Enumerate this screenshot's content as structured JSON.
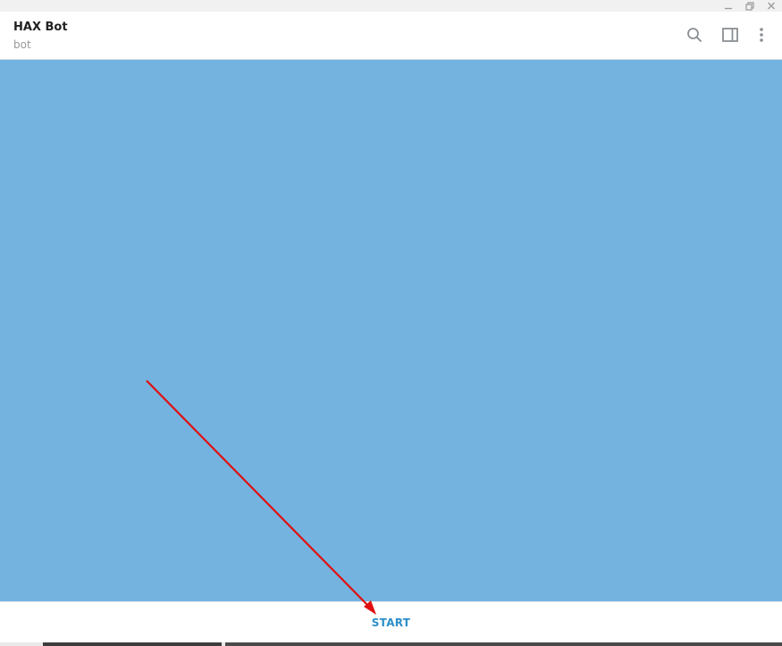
{
  "window": {
    "controls": [
      {
        "name": "minimize",
        "icon": "minimize-icon"
      },
      {
        "name": "restore",
        "icon": "restore-icon"
      },
      {
        "name": "close",
        "icon": "close-icon"
      }
    ]
  },
  "header": {
    "title": "HAX Bot",
    "status": "bot",
    "icons": [
      "search-icon",
      "sidebar-toggle-icon",
      "more-vertical-icon"
    ]
  },
  "chat": {
    "background_color": "#74b3df"
  },
  "bottom_bar": {
    "start_label": "START",
    "accent_color": "#2b8fc9"
  },
  "annotation": {
    "type": "arrow",
    "color": "#e01010"
  }
}
